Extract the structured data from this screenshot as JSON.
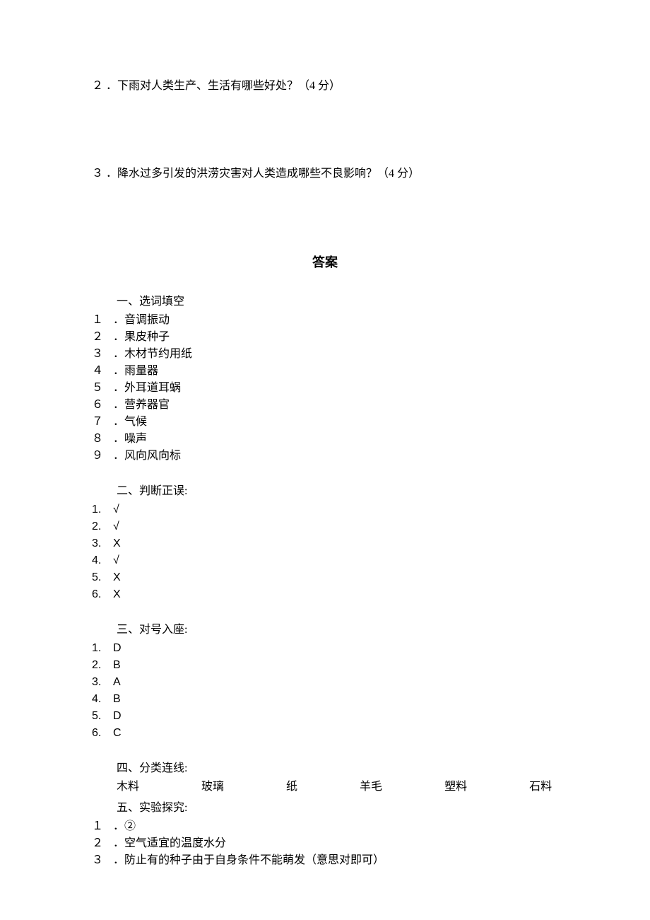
{
  "questions": {
    "q2": {
      "num": "２",
      "text": "．下雨对人类生产、生活有哪些好处？（4 分）"
    },
    "q3": {
      "num": "３",
      "text": "．降水过多引发的洪涝灾害对人类造成哪些不良影响？（4 分）"
    }
  },
  "answer_title": "答案",
  "section1": {
    "heading": "一、选词填空",
    "items": [
      {
        "num": "１",
        "text": "．音调振动"
      },
      {
        "num": "２",
        "text": "．果皮种子"
      },
      {
        "num": "３",
        "text": "．木材节约用纸"
      },
      {
        "num": "４",
        "text": "．雨量器"
      },
      {
        "num": "５",
        "text": "．外耳道耳蜗"
      },
      {
        "num": "６",
        "text": "．营养器官"
      },
      {
        "num": "７",
        "text": "．气候"
      },
      {
        "num": "８",
        "text": "．噪声"
      },
      {
        "num": "９",
        "text": "．风向风向标"
      }
    ]
  },
  "section2": {
    "heading": "二、判断正误:",
    "items": [
      {
        "num": "1.",
        "text": "√"
      },
      {
        "num": "2.",
        "text": "√"
      },
      {
        "num": "3.",
        "text": "X"
      },
      {
        "num": "4.",
        "text": "√"
      },
      {
        "num": "5.",
        "text": "X"
      },
      {
        "num": "6.",
        "text": "X"
      }
    ]
  },
  "section3": {
    "heading": "三、对号入座:",
    "items": [
      {
        "num": "1.",
        "text": "D"
      },
      {
        "num": "2.",
        "text": "B"
      },
      {
        "num": "3.",
        "text": "A"
      },
      {
        "num": "4.",
        "text": "B"
      },
      {
        "num": "5.",
        "text": "D"
      },
      {
        "num": "6.",
        "text": "C"
      }
    ]
  },
  "section4": {
    "heading": "四、分类连线:",
    "items": [
      "木料",
      "玻璃",
      "纸",
      "羊毛",
      "塑料",
      "石料"
    ]
  },
  "section5": {
    "heading": "五、实验探究:",
    "items": [
      {
        "num": "１",
        "text": "．②"
      },
      {
        "num": "２",
        "text": "．空气适宜的温度水分"
      },
      {
        "num": "３",
        "text": "．防止有的种子由于自身条件不能萌发（意思对即可）"
      }
    ]
  }
}
